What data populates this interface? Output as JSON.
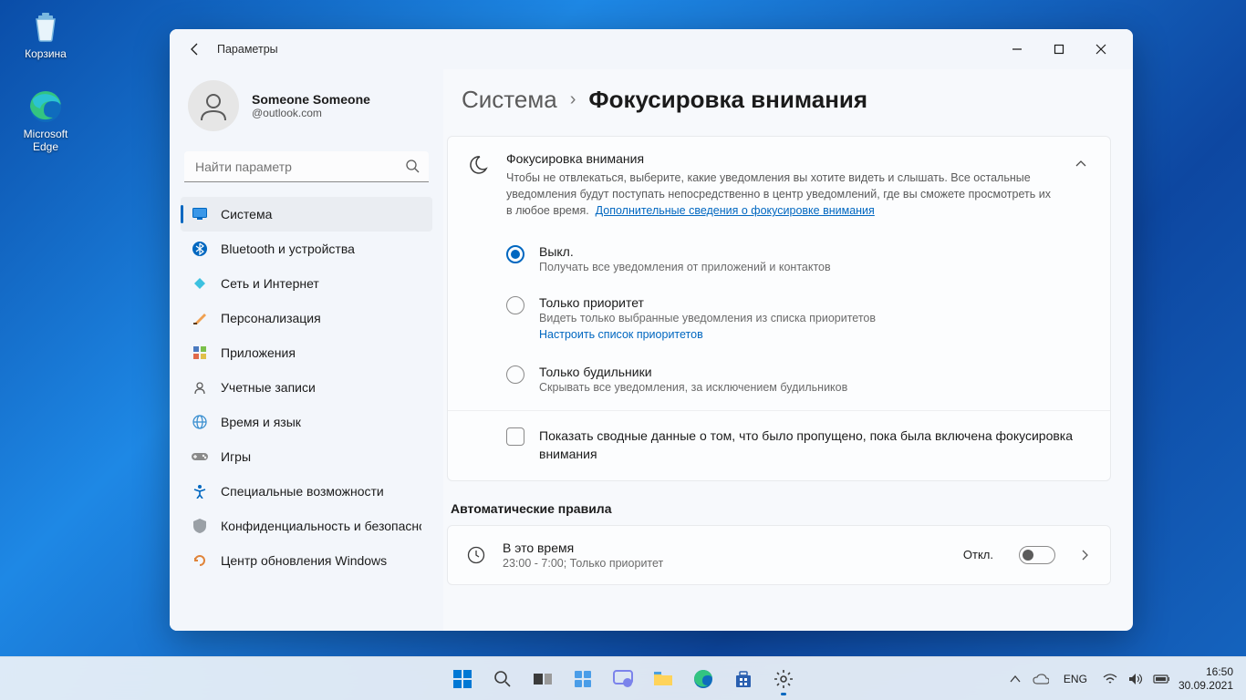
{
  "desktop": {
    "icons": [
      {
        "label": "Корзина"
      },
      {
        "label": "Microsoft Edge"
      }
    ]
  },
  "window": {
    "title": "Параметры"
  },
  "profile": {
    "name": "Someone Someone",
    "email": "@outlook.com"
  },
  "search": {
    "placeholder": "Найти параметр"
  },
  "sidebar": {
    "items": [
      {
        "label": "Система"
      },
      {
        "label": "Bluetooth и устройства"
      },
      {
        "label": "Сеть и Интернет"
      },
      {
        "label": "Персонализация"
      },
      {
        "label": "Приложения"
      },
      {
        "label": "Учетные записи"
      },
      {
        "label": "Время и язык"
      },
      {
        "label": "Игры"
      },
      {
        "label": "Специальные возможности"
      },
      {
        "label": "Конфиденциальность и безопасность"
      },
      {
        "label": "Центр обновления Windows"
      }
    ]
  },
  "breadcrumb": {
    "parent": "Система",
    "current": "Фокусировка внимания"
  },
  "focus": {
    "title": "Фокусировка внимания",
    "description": "Чтобы не отвлекаться, выберите, какие уведомления вы хотите видеть и слышать. Все остальные уведомления будут поступать непосредственно в центр уведомлений, где вы сможете просмотреть их в любое время.",
    "link": "Дополнительные сведения о фокусировке внимания",
    "options": [
      {
        "label": "Выкл.",
        "desc": "Получать все уведомления от приложений и контактов"
      },
      {
        "label": "Только приоритет",
        "desc": "Видеть только выбранные уведомления из списка приоритетов",
        "link": "Настроить список приоритетов"
      },
      {
        "label": "Только будильники",
        "desc": "Скрывать все уведомления, за исключением будильников"
      }
    ],
    "summary_checkbox": "Показать сводные данные о том, что было пропущено, пока была включена фокусировка внимания"
  },
  "rules": {
    "title": "Автоматические правила",
    "time_rule": {
      "title": "В это время",
      "desc": "23:00 - 7:00; Только приоритет",
      "state": "Откл."
    }
  },
  "taskbar": {
    "lang": "ENG",
    "time": "16:50",
    "date": "30.09.2021"
  }
}
